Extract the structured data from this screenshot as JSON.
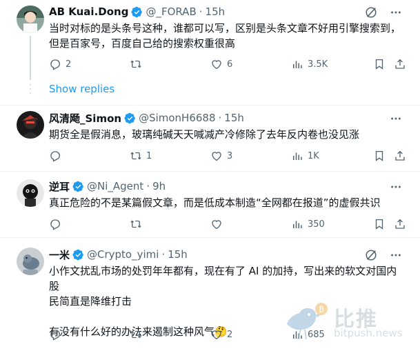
{
  "colors": {
    "accent": "#1d9bf0",
    "muted": "#536471",
    "text": "#0f1419",
    "divider": "#eff3f4"
  },
  "thread": {
    "show_replies": "Show replies"
  },
  "tweets": [
    {
      "name": "AB Kuai.Dong",
      "handle": "@_FORAB",
      "dot": "·",
      "time": "15h",
      "text": "当时对标的是头条号这种，谁都可以写，区别是头条文章不好用引擎搜索到，\n但是百家号，百度自己给的搜索权重很高",
      "stats": {
        "replies": "2",
        "retweets": "",
        "likes": "6",
        "views": "3.5K"
      }
    },
    {
      "name": "风清飏_Simon",
      "handle": "@SimonH6688",
      "dot": "·",
      "time": "15h",
      "text": "期货全是假消息，玻璃纯碱天天喊减产冷修除了去年反内卷也没见涨",
      "stats": {
        "replies": "",
        "retweets": "1",
        "likes": "3",
        "views": "1K"
      }
    },
    {
      "name": "逆耳",
      "handle": "@Ni_Agent",
      "dot": "·",
      "time": "9h",
      "text": "真正危险的不是某篇假文章，而是低成本制造“全网都在报道”的虚假共识",
      "stats": {
        "replies": "",
        "retweets": "",
        "likes": "",
        "views": "350"
      }
    },
    {
      "name": "一米",
      "handle": "@Crypto_yimi",
      "dot": "·",
      "time": "15h",
      "text": "小作文扰乱市场的处罚年年都有，现在有了 AI 的加持，写出来的软文对国内股\n民简直是降维打击\n\n有没有什么好的办法来遏制这种风气🤔",
      "stats": {
        "replies": "",
        "retweets": "",
        "likes": "2",
        "views": "685"
      }
    }
  ],
  "watermark": {
    "cn": "比推",
    "en": "bitpush.news"
  }
}
